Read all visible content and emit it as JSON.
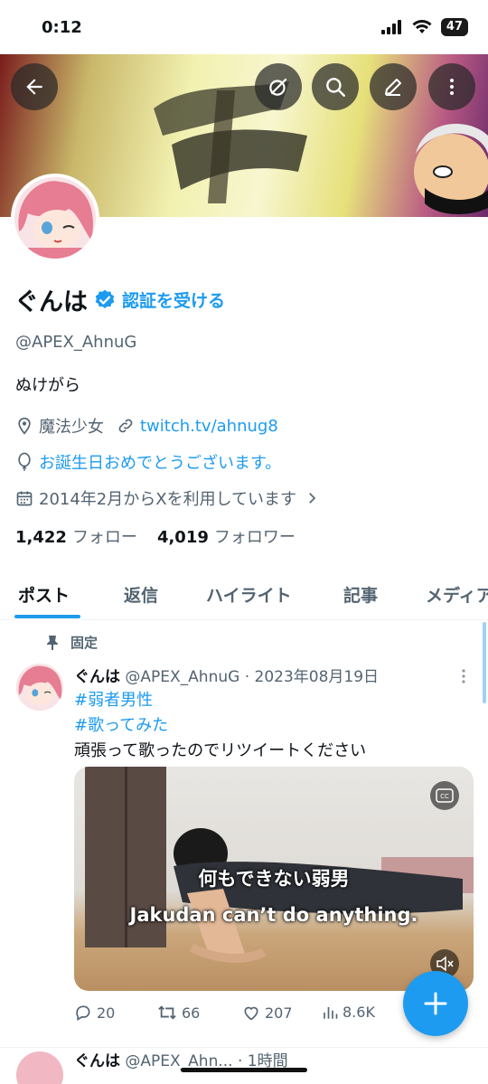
{
  "status_bar": {
    "time": "0:12",
    "battery": "47"
  },
  "profile": {
    "name": "ぐんは",
    "verify_link": "認証を受ける",
    "handle": "@APEX_AhnuG",
    "bio": "ぬけがら",
    "location": "魔法少女",
    "website": "twitch.tv/ahnug8",
    "birthday": "お誕生日おめでとうございます。",
    "joined": "2014年2月からXを利用しています",
    "following_count": "1,422",
    "following_label": "フォロー",
    "followers_count": "4,019",
    "followers_label": "フォロワー"
  },
  "tabs": [
    "ポスト",
    "返信",
    "ハイライト",
    "記事",
    "メディア"
  ],
  "pinned_post": {
    "pinned_label": "固定",
    "author": "ぐんは",
    "meta": "@APEX_AhnuG · 2023年08月19日",
    "hashtags": [
      "#弱者男性",
      "#歌ってみた"
    ],
    "text": "頑張って歌ったのでリツイートください",
    "video_caption_ja": "何もできない弱男",
    "video_caption_en": "Jakudan can’t do anything.",
    "replies": "20",
    "reposts": "66",
    "likes": "207",
    "views": "8.6K"
  },
  "next_post": {
    "author": "ぐんは",
    "meta": "@APEX_Ahn... · 1時間"
  },
  "icons": [
    "back-arrow-icon",
    "slash-circle-icon",
    "search-icon",
    "edit-pencil-icon",
    "more-vertical-icon",
    "verified-badge-icon",
    "location-icon",
    "link-icon",
    "balloon-icon",
    "calendar-icon",
    "pin-icon",
    "reply-icon",
    "repost-icon",
    "like-icon",
    "views-icon",
    "cc-icon",
    "mute-icon",
    "plus-icon"
  ],
  "colors": {
    "accent": "#1d9bf0",
    "text": "#0f1419",
    "secondary": "#536471"
  }
}
